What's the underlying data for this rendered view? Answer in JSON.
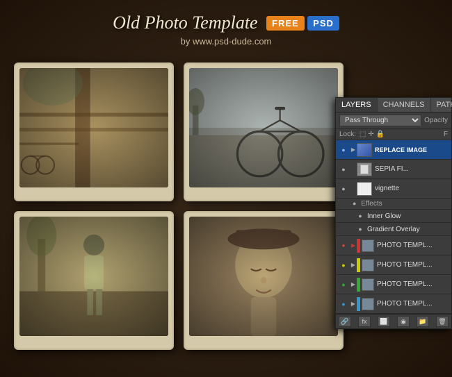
{
  "header": {
    "title": "Old Photo Template",
    "free_label": "FREE",
    "psd_label": "PSD",
    "subtitle": "by www.psd-dude.com"
  },
  "panel": {
    "tabs": [
      {
        "label": "LAYERS",
        "active": true
      },
      {
        "label": "CHANNELS",
        "active": false
      },
      {
        "label": "PATHS",
        "active": false
      }
    ],
    "blend_mode": "Pass Through",
    "opacity_label": "Opacity",
    "lock_label": "Lock:",
    "fill_label": "F",
    "layers": [
      {
        "name": "REPLACE IMAGE",
        "type": "folder",
        "color": "blue",
        "eye": true,
        "triangle": true
      },
      {
        "name": "SEPIA FI...",
        "type": "adjustment",
        "color": "none",
        "eye": true,
        "triangle": false
      },
      {
        "name": "vignette",
        "type": "solid",
        "color": "none",
        "eye": true,
        "triangle": false
      },
      {
        "name": "Effects",
        "type": "effects-header"
      },
      {
        "name": "Inner Glow",
        "type": "effect-item",
        "eye": true
      },
      {
        "name": "Gradient Overlay",
        "type": "effect-item",
        "eye": true
      },
      {
        "name": "PHOTO TEMPL...",
        "type": "folder",
        "color": "red",
        "eye": true,
        "triangle": true
      },
      {
        "name": "PHOTO TEMPL...",
        "type": "folder",
        "color": "yellow",
        "eye": true,
        "triangle": true
      },
      {
        "name": "PHOTO TEMPL...",
        "type": "folder",
        "color": "green",
        "eye": true,
        "triangle": true
      },
      {
        "name": "PHOTO TEMPL...",
        "type": "folder",
        "color": "blue2",
        "eye": true,
        "triangle": true
      }
    ],
    "toolbar_buttons": [
      "link",
      "fx",
      "mask",
      "adjust",
      "folder",
      "trash"
    ]
  }
}
